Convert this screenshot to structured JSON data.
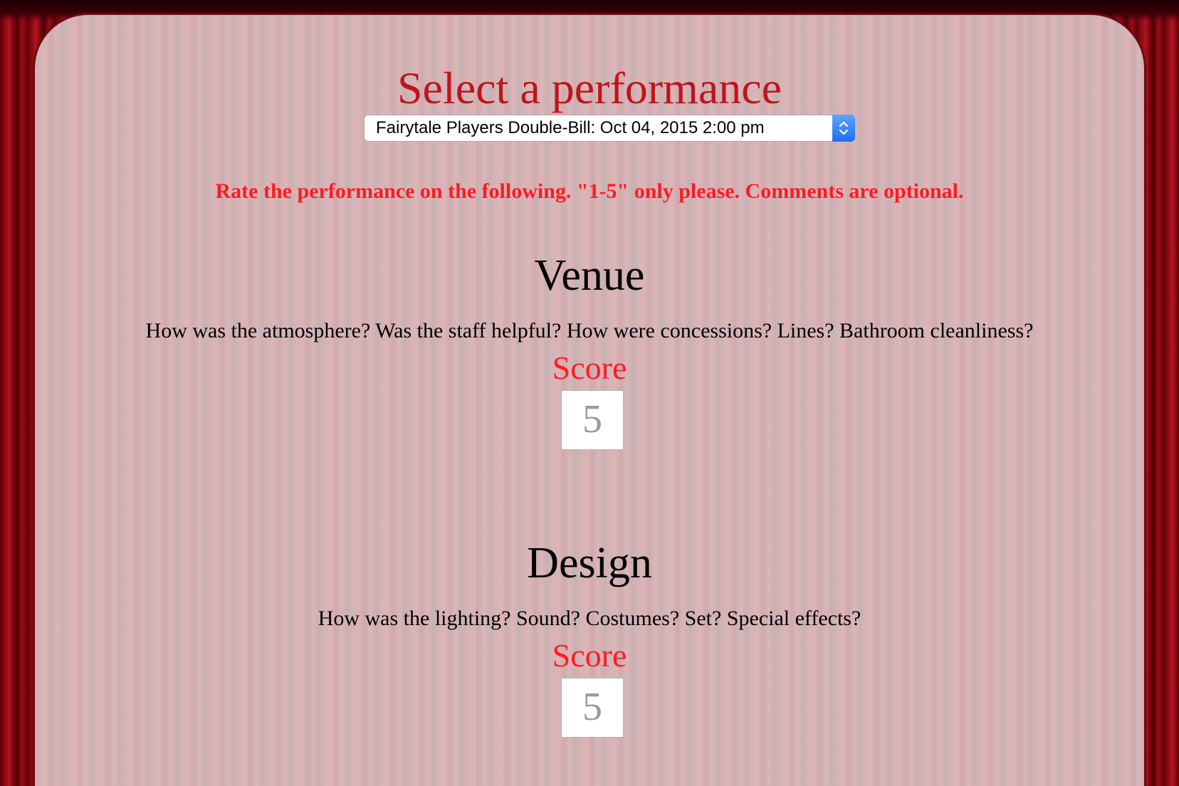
{
  "header": {
    "title": "Select a performance",
    "performance_select": {
      "selected": "Fairytale Players Double-Bill: Oct 04, 2015 2:00 pm",
      "stepper_icon": "updown-chevron-icon"
    },
    "instructions": "Rate the performance on the following. \"1-5\" only please. Comments are optional."
  },
  "sections": [
    {
      "title": "Venue",
      "question": "How was the atmosphere? Was the staff helpful? How were concessions? Lines? Bathroom cleanliness?",
      "score_label": "Score",
      "score_value": "5"
    },
    {
      "title": "Design",
      "question": "How was the lighting? Sound? Costumes? Set? Special effects?",
      "score_label": "Score",
      "score_value": "5"
    }
  ],
  "colors": {
    "title_red": "#c0141c",
    "accent_red": "#ff1a24",
    "curtain": "#8e0a14",
    "stepper_blue": "#1e6ef0"
  }
}
